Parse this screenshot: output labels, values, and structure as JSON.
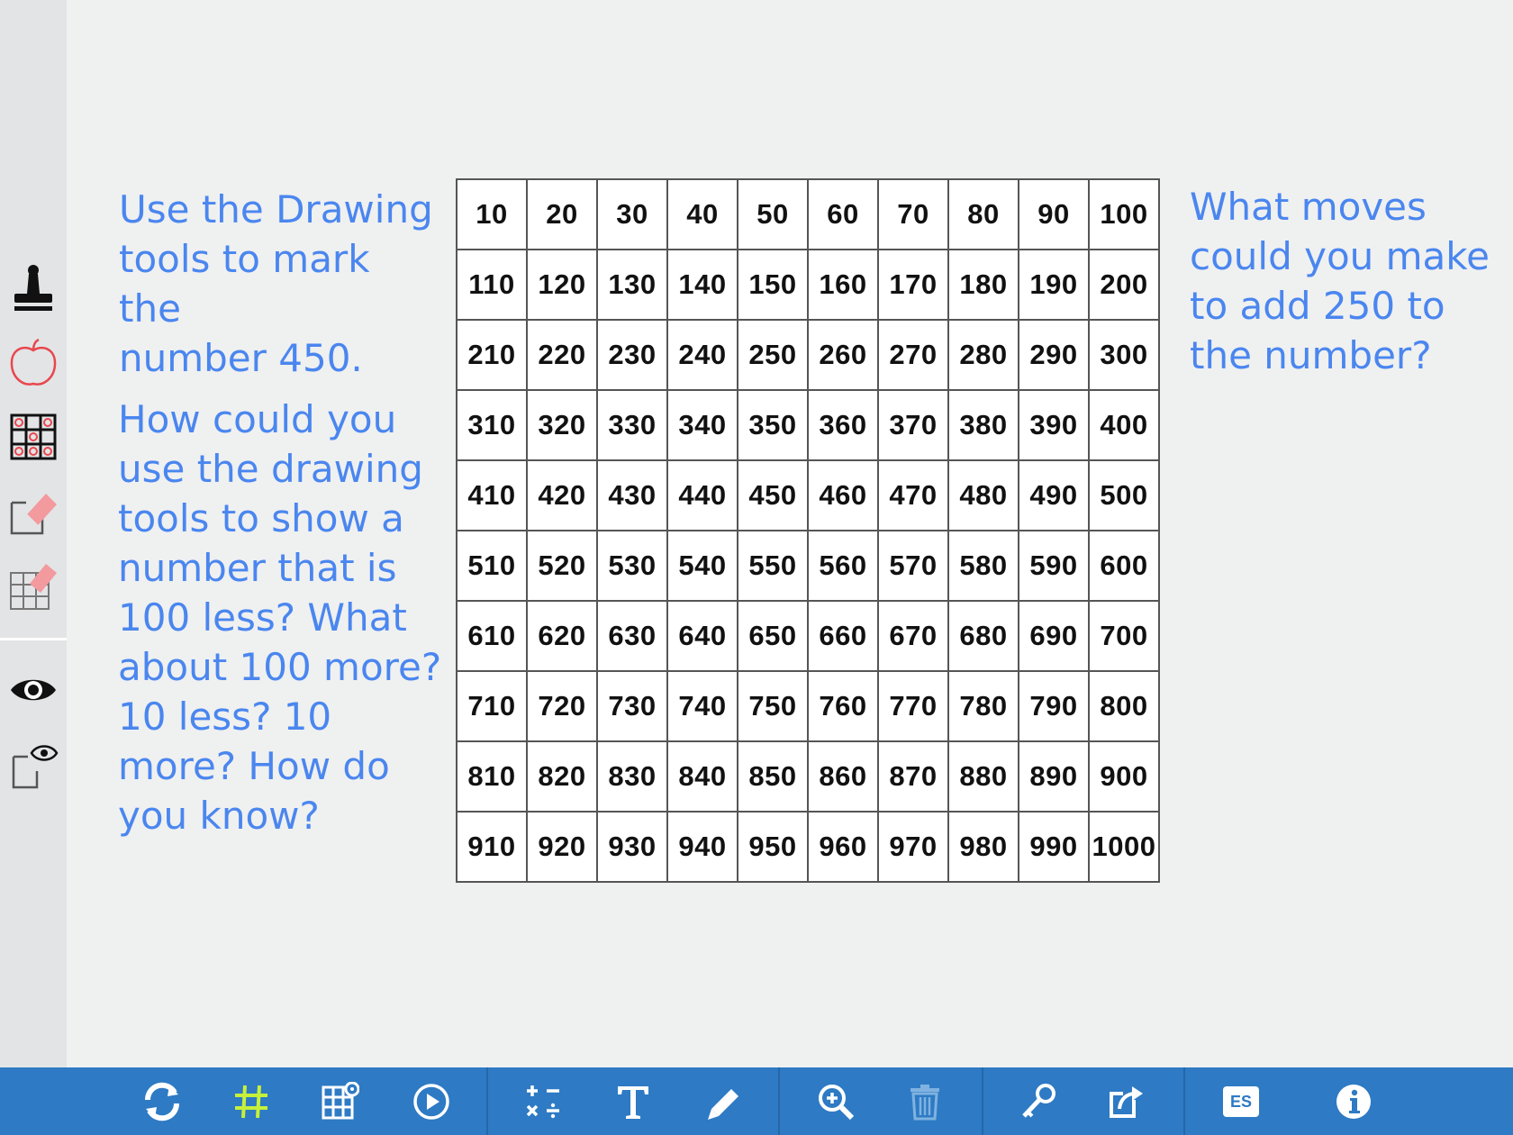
{
  "sidebar": {
    "tools": [
      {
        "icon": "stamp-icon"
      },
      {
        "icon": "apple-outline-icon"
      },
      {
        "icon": "grid-counters-icon"
      },
      {
        "icon": "erase-page-icon"
      },
      {
        "icon": "erase-grid-icon"
      },
      {
        "icon": "show-eye-icon"
      },
      {
        "icon": "reveal-page-icon"
      }
    ]
  },
  "prompts": {
    "left_top": "Use the Drawing\ntools to mark the\nnumber 450.",
    "left_bottom": "How could you\nuse the drawing\ntools to show a\nnumber that is\n100 less? What\nabout 100 more?\n10 less? 10\nmore? How do\nyou know?",
    "right": "What moves\ncould you make\nto add 250 to\nthe number?"
  },
  "grid": {
    "rows": [
      [
        "10",
        "20",
        "30",
        "40",
        "50",
        "60",
        "70",
        "80",
        "90",
        "100"
      ],
      [
        "110",
        "120",
        "130",
        "140",
        "150",
        "160",
        "170",
        "180",
        "190",
        "200"
      ],
      [
        "210",
        "220",
        "230",
        "240",
        "250",
        "260",
        "270",
        "280",
        "290",
        "300"
      ],
      [
        "310",
        "320",
        "330",
        "340",
        "350",
        "360",
        "370",
        "380",
        "390",
        "400"
      ],
      [
        "410",
        "420",
        "430",
        "440",
        "450",
        "460",
        "470",
        "480",
        "490",
        "500"
      ],
      [
        "510",
        "520",
        "530",
        "540",
        "550",
        "560",
        "570",
        "580",
        "590",
        "600"
      ],
      [
        "610",
        "620",
        "630",
        "640",
        "650",
        "660",
        "670",
        "680",
        "690",
        "700"
      ],
      [
        "710",
        "720",
        "730",
        "740",
        "750",
        "760",
        "770",
        "780",
        "790",
        "800"
      ],
      [
        "810",
        "820",
        "830",
        "840",
        "850",
        "860",
        "870",
        "880",
        "890",
        "900"
      ],
      [
        "910",
        "920",
        "930",
        "940",
        "950",
        "960",
        "970",
        "980",
        "990",
        "1000"
      ]
    ]
  },
  "toolbar": {
    "language_label": "ES",
    "colors": {
      "background": "#2e7ac4",
      "active_grid": "#c6f03a"
    }
  },
  "colors": {
    "prompt_text": "#4a86ef",
    "grid_border": "#3a36b4"
  }
}
